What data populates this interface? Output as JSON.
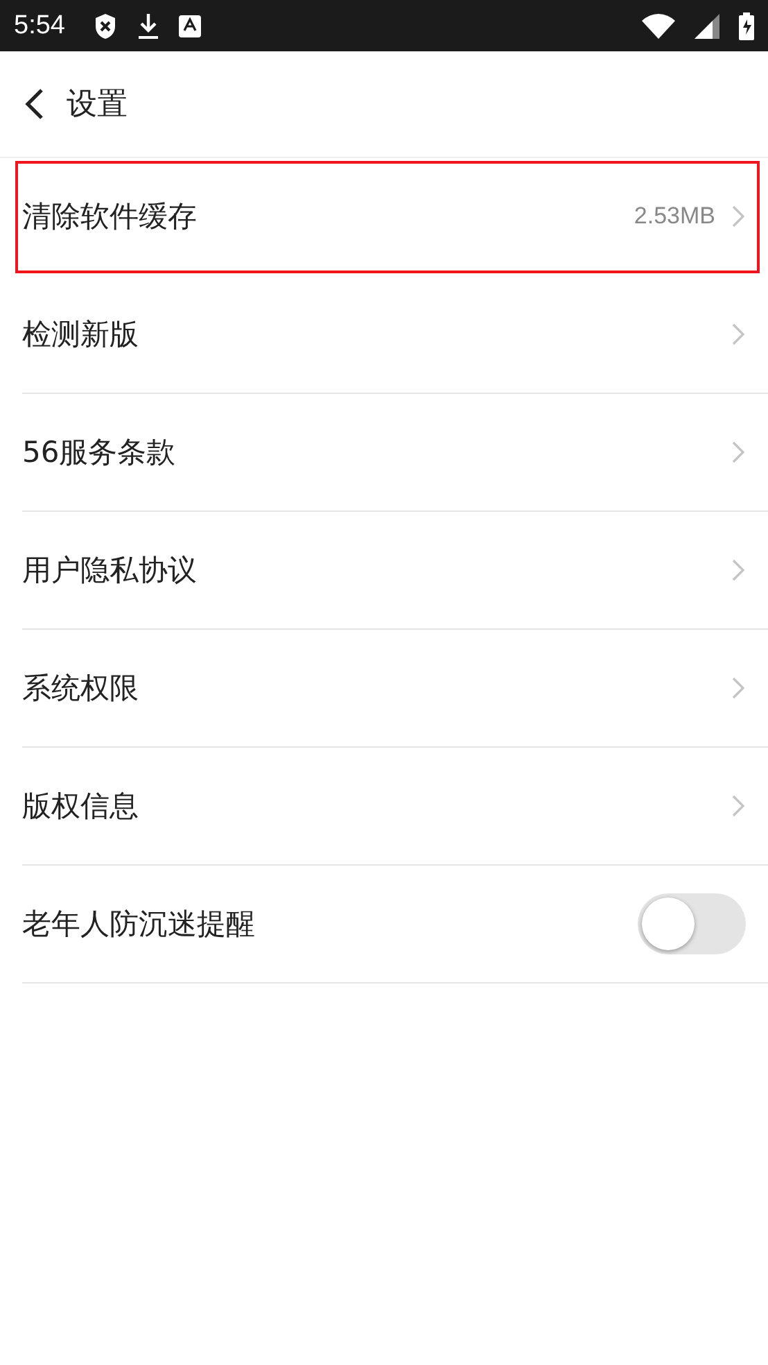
{
  "status_bar": {
    "time": "5:54"
  },
  "header": {
    "title": "设置"
  },
  "items": [
    {
      "kind": "link",
      "label": "清除软件缓存",
      "value": "2.53MB",
      "highlighted": true
    },
    {
      "kind": "link",
      "label": "检测新版",
      "highlighted": false
    },
    {
      "kind": "link",
      "label": "56服务条款",
      "highlighted": false
    },
    {
      "kind": "link",
      "label": "用户隐私协议",
      "highlighted": false
    },
    {
      "kind": "link",
      "label": "系统权限",
      "highlighted": false
    },
    {
      "kind": "link",
      "label": "版权信息",
      "highlighted": false
    },
    {
      "kind": "toggle",
      "label": "老年人防沉迷提醒",
      "on": false,
      "highlighted": false
    }
  ]
}
